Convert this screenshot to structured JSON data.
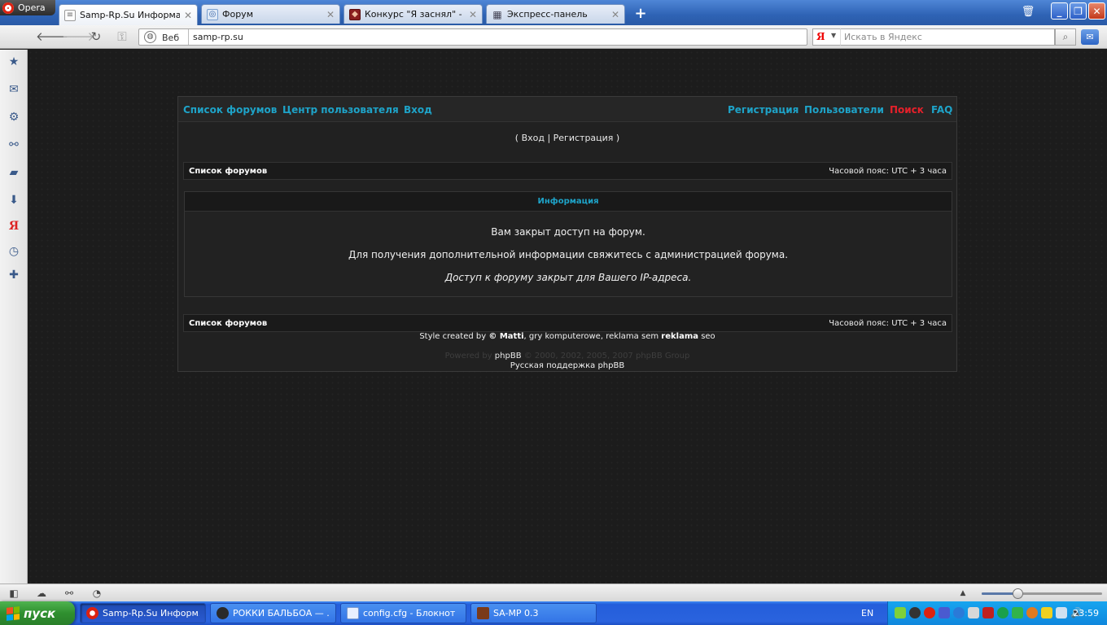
{
  "browser": {
    "app_name": "Opera",
    "tabs": [
      {
        "title": "Samp-Rp.Su Информация",
        "active": true
      },
      {
        "title": "Форум",
        "active": false
      },
      {
        "title": "Конкурс \"Я заснял\" - М...",
        "active": false
      },
      {
        "title": "Экспресс-панель",
        "active": false
      }
    ],
    "address": {
      "web_label": "Веб",
      "url": "samp-rp.su"
    },
    "search": {
      "placeholder": "Искать в Яндекс"
    },
    "zoom_fraction": 0.3
  },
  "forum": {
    "nav_left": [
      "Список форумов",
      "Центр пользователя",
      "Вход"
    ],
    "nav_right": [
      "Регистрация",
      "Пользователи",
      "Поиск",
      "FAQ"
    ],
    "login_line": "( Вход | Регистрация )",
    "top_bar": {
      "left": "Список форумов",
      "right": "Часовой пояс: UTC + 3 часа"
    },
    "info": {
      "title": "Информация",
      "line1": "Вам закрыт доступ на форум.",
      "line2": "Для получения дополнительной информации свяжитесь с администрацией форума.",
      "line3": "Доступ к форуму закрыт для Вашего IP-адреса."
    },
    "bottom_bar": {
      "left": "Список форумов",
      "right": "Часовой пояс: UTC + 3 часа"
    },
    "footer": {
      "style_prefix": "Style created by",
      "style_author": "© Matti",
      "style_mid": ", gry komputerowe, reklama sem",
      "style_bold": "reklama",
      "style_end": "seo",
      "powered_prefix": "Powered by",
      "powered_link": "phpBB",
      "powered_suffix": "© 2000, 2002, 2005, 2007 phpBB Group",
      "ru_support": "Русская поддержка phpBB"
    }
  },
  "taskbar": {
    "start_label": "пуск",
    "tasks": [
      {
        "title": "Samp-Rp.Su Информ...",
        "active": true
      },
      {
        "title": "РОККИ БАЛЬБОА — ...",
        "active": false
      },
      {
        "title": "config.cfg - Блокнот",
        "active": false
      },
      {
        "title": "SA-MP 0.3",
        "active": false
      }
    ],
    "language": "EN",
    "clock": "23:59"
  },
  "colors": {
    "forum_link": "#1ea3c8",
    "forum_link_red": "#e6202a",
    "xp_taskbar": "#245edb",
    "xp_start": "#3c9a3c"
  },
  "icons": {
    "side_panel": [
      "star-icon",
      "mail-icon",
      "gear-icon",
      "share-icon",
      "note-icon",
      "download-icon",
      "yandex-icon",
      "clock-icon",
      "plus-icon"
    ],
    "status_bar": [
      "panel-toggle-icon",
      "cloud-icon",
      "unite-icon",
      "speed-dial-icon",
      "up-arrow-icon"
    ]
  }
}
